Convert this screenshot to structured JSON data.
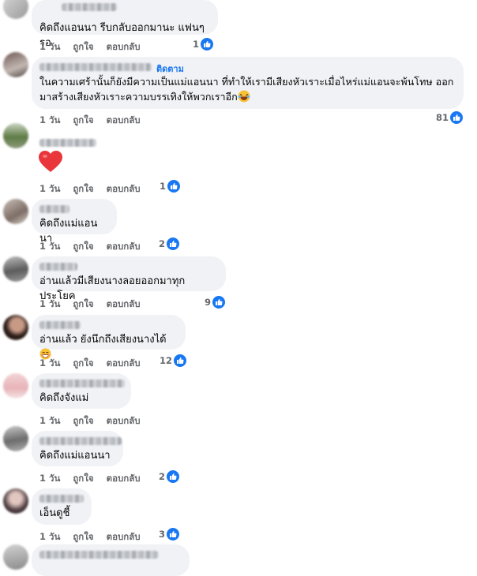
{
  "comments": [
    {
      "text": "คิดถึงแอนนา รีบกลับออกมานะ แฟนๆรอ",
      "time": "1 วัน",
      "like": "ถูกใจ",
      "reply": "ตอบกลับ",
      "count": "1"
    },
    {
      "follow": "ติดตาม",
      "text_line1": "ในความเศร้านั้นก็ยังมีความเป็นแม่แอนนา ที่ทำให้เรามีเสียงหัวเราะเมื่อไหร่แม่แอนจะพ้นโทษ ออก",
      "text_line2": "มาสร้างเสียงหัวเราะความบรรเทิงให้พวกเราอีก",
      "time": "1 วัน",
      "like": "ถูกใจ",
      "reply": "ตอบกลับ",
      "count": "81"
    },
    {
      "time": "1 วัน",
      "like": "ถูกใจ",
      "reply": "ตอบกลับ",
      "count": "1"
    },
    {
      "text": "คิดถึงแม่แอนนา",
      "time": "1 วัน",
      "like": "ถูกใจ",
      "reply": "ตอบกลับ",
      "count": "2"
    },
    {
      "text": "อ่านแล้วมีเสียงนางลอยออกมาทุกประโยค",
      "time": "1 วัน",
      "like": "ถูกใจ",
      "reply": "ตอบกลับ",
      "count": "9"
    },
    {
      "text": "อ่านแล้ว ยังนึกถึงเสียงนางได้",
      "time": "1 วัน",
      "like": "ถูกใจ",
      "reply": "ตอบกลับ",
      "count": "12"
    },
    {
      "text": "คิดถึงจังแม่",
      "time": "1 วัน",
      "like": "ถูกใจ",
      "reply": "ตอบกลับ",
      "count": ""
    },
    {
      "text": "คิดถึงแม่แอนนา",
      "time": "1 วัน",
      "like": "ถูกใจ",
      "reply": "ตอบกลับ",
      "count": "2"
    },
    {
      "text": "เอ็นดูชี้",
      "time": "1 วัน",
      "like": "ถูกใจ",
      "reply": "ตอบกลับ",
      "count": "3"
    }
  ],
  "colors": {
    "accent": "#1877f2",
    "bubble": "#f0f2f5",
    "meta": "#65676b"
  },
  "icons": {
    "like": "like-thumb-icon",
    "heart": "heart-emoji-icon",
    "laugh": "laughing-emoji-icon",
    "grin": "grinning-emoji-icon"
  }
}
